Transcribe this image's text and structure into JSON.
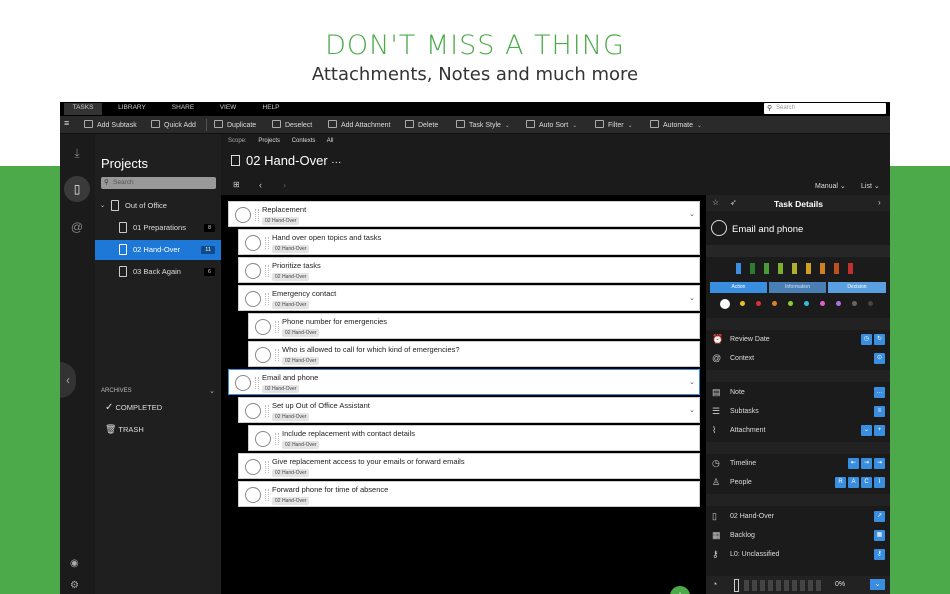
{
  "headline": "DON'T MISS A THING",
  "subheadline": "Attachments, Notes and much more",
  "menubar": {
    "items": [
      "TASKS",
      "LIBRARY",
      "SHARE",
      "VIEW",
      "HELP"
    ],
    "search_placeholder": "Search"
  },
  "toolbar": {
    "add_subtask": "Add Subtask",
    "quick_add": "Quick Add",
    "duplicate": "Duplicate",
    "deselect": "Deselect",
    "add_attachment": "Add Attachment",
    "delete": "Delete",
    "task_style": "Task Style",
    "auto_sort": "Auto Sort",
    "filter": "Filter",
    "automate": "Automate"
  },
  "sidebar": {
    "title": "Projects",
    "search_placeholder": "Search",
    "folder": "Out of Office",
    "projects": [
      {
        "label": "01 Preparations",
        "count": "8"
      },
      {
        "label": "02 Hand-Over",
        "count": "11"
      },
      {
        "label": "03 Back Again",
        "count": "6"
      }
    ],
    "archives_label": "ARCHIVES",
    "completed": "COMPLETED",
    "trash": "TRASH"
  },
  "main": {
    "scope_label": "Scope:",
    "scope_options": [
      "Projects",
      "Contexts",
      "All"
    ],
    "title": "02 Hand-Over",
    "title_more": "···",
    "sort": "Manual",
    "view": "List"
  },
  "tasks": [
    {
      "title": "Replacement",
      "tag": "02 Hand-Over"
    },
    {
      "title": "Hand over open topics and tasks",
      "tag": "02 Hand-Over"
    },
    {
      "title": "Prioritize tasks",
      "tag": "02 Hand-Over"
    },
    {
      "title": "Emergency contact",
      "tag": "02 Hand-Over"
    },
    {
      "title": "Phone number for emergencies",
      "tag": "02 Hand-Over"
    },
    {
      "title": "Who is allowed to call for which kind of emergencies?",
      "tag": "02 Hand-Over"
    },
    {
      "title": "Email and phone",
      "tag": "02 Hand-Over"
    },
    {
      "title": "Set up Out of Office Assistant",
      "tag": "02 Hand-Over"
    },
    {
      "title": "Include replacement with contact details",
      "tag": "02 Hand-Over"
    },
    {
      "title": "Give replacement access to your emails or forward emails",
      "tag": "02 Hand-Over"
    },
    {
      "title": "Forward phone for time of absence",
      "tag": "02 Hand-Over"
    }
  ],
  "details": {
    "header": "Task Details",
    "task_name": "Email and phone",
    "priority_tabs": [
      "Action",
      "Information",
      "Decision"
    ],
    "rows": {
      "review_date": "Review Date",
      "context": "Context",
      "note": "Note",
      "subtasks": "Subtasks",
      "attachment": "Attachment",
      "timeline": "Timeline",
      "people": "People",
      "project": "02 Hand-Over",
      "backlog": "Backlog",
      "level": "L0: Unclassified"
    },
    "people_buttons": [
      "R",
      "A",
      "C",
      "I"
    ],
    "progress": "0%"
  },
  "colors": {
    "brand_green": "#4caa4a",
    "selection_blue": "#1e78d7",
    "accent_blue": "#3a8ee0"
  }
}
